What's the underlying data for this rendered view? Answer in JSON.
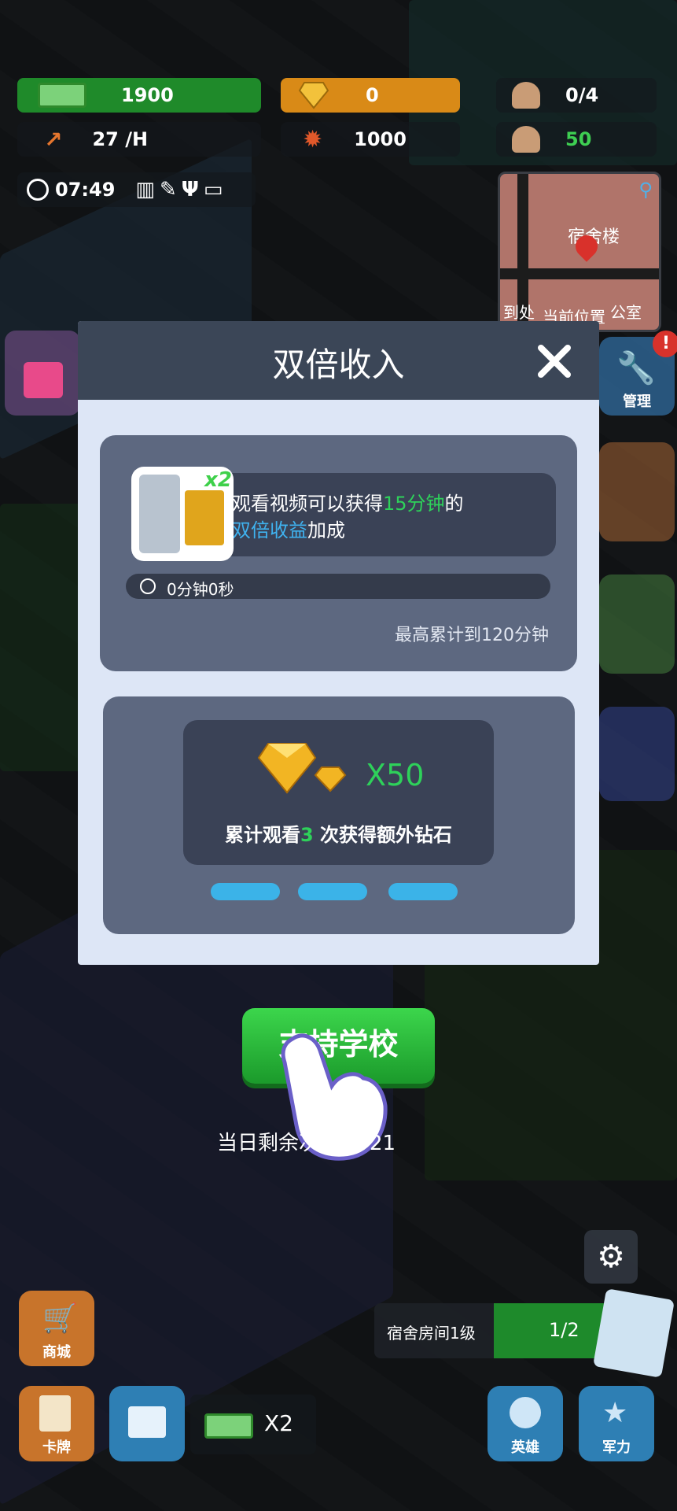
{
  "hud": {
    "money": "1900",
    "income": "27 /H",
    "diamonds": "0",
    "gear_value": "1000",
    "staff": "0/4",
    "students": "50",
    "clock": "07:49"
  },
  "minimap": {
    "label_top": "宿舍楼",
    "label_bottom_left": "到处",
    "label_bottom_right": "当前位置",
    "label_room": "公室"
  },
  "side_menu": {
    "manage": "管理"
  },
  "modal": {
    "title": "双倍收入",
    "offer_badge": "x2",
    "offer_text": {
      "part1": "观看视频可以获得",
      "minutes": "15分钟",
      "part2": "的",
      "bonus": "双倍收益",
      "part3": "加成"
    },
    "timer": "0分钟0秒",
    "max_note": "最高累计到120分钟",
    "reward_amount": "X50",
    "reward_text": {
      "part1": "累计观看",
      "count": "3",
      "part2": " 次获得额外钻石"
    }
  },
  "support_button": "支持学校",
  "remaining": {
    "label": "当日剩余次数：",
    "value": "21"
  },
  "task": {
    "text": "宿舍房间1级",
    "progress": "1/2"
  },
  "bottom": {
    "shop": "商城",
    "cards": "卡牌",
    "video_multiplier": "X2",
    "heroes": "英雄",
    "military": "军力"
  },
  "colors": {
    "accent_green": "#2ed15a",
    "accent_blue": "#3fb2ef",
    "modal_bg": "#dde6f6",
    "modal_header": "#3b4657"
  }
}
